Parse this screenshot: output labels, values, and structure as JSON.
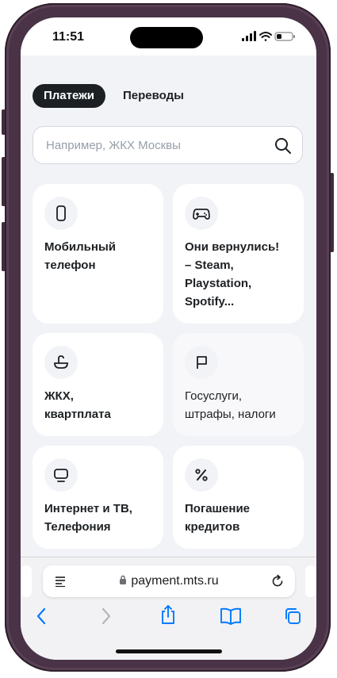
{
  "status_bar": {
    "time": "11:51"
  },
  "tabs": [
    {
      "label": "Платежи",
      "active": true
    },
    {
      "label": "Переводы",
      "active": false
    }
  ],
  "search": {
    "placeholder": "Например, ЖКХ Москвы"
  },
  "cards": [
    {
      "label": "Мобильный\nтелефон",
      "icon": "mobile-phone-icon"
    },
    {
      "label": "Они вернулись!\n– Steam,\nPlaystation,\nSpotify...",
      "icon": "gamepad-icon"
    },
    {
      "label": "ЖКХ,\nквартплата",
      "icon": "faucet-icon"
    },
    {
      "label": "Госуслуги,\nштрафы, налоги",
      "icon": "flag-icon"
    },
    {
      "label": "Интернет и ТВ,\nТелефония",
      "icon": "monitor-icon"
    },
    {
      "label": "Погашение\nкредитов",
      "icon": "percent-icon"
    }
  ],
  "browser": {
    "url": "payment.mts.ru"
  },
  "colors": {
    "frame": "#4a3346",
    "background": "#f2f3f7",
    "active_tab": "#1d2023",
    "ios_blue": "#007aff"
  }
}
